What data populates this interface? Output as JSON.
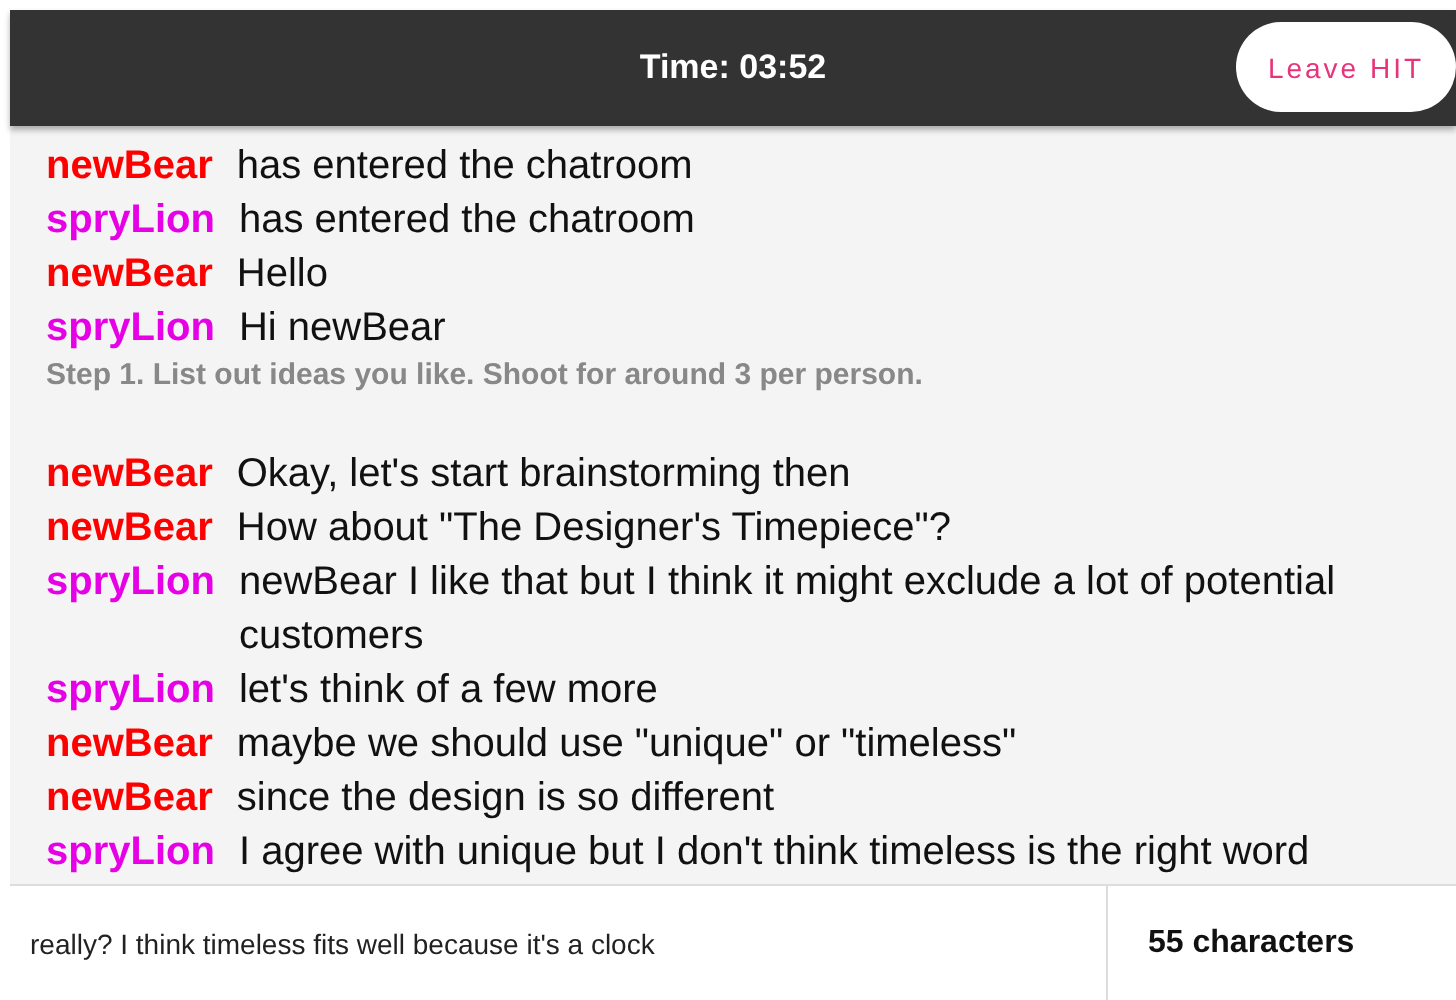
{
  "header": {
    "timer": "Time: 03:52",
    "leave_button": "Leave HIT"
  },
  "messages": [
    {
      "kind": "message",
      "user": "newBear",
      "color": "#ff0000",
      "text": "has entered the chatroom"
    },
    {
      "kind": "message",
      "user": "spryLion",
      "color": "#e600e6",
      "text": "has entered the chatroom"
    },
    {
      "kind": "message",
      "user": "newBear",
      "color": "#ff0000",
      "text": "Hello"
    },
    {
      "kind": "message",
      "user": "spryLion",
      "color": "#e600e6",
      "text": "Hi newBear"
    },
    {
      "kind": "instruction",
      "text": "Step 1. List out ideas you like. Shoot for around 3 per person."
    },
    {
      "kind": "message",
      "user": "newBear",
      "color": "#ff0000",
      "text": "Okay, let's start brainstorming then"
    },
    {
      "kind": "message",
      "user": "newBear",
      "color": "#ff0000",
      "text": "How about \"The Designer's Timepiece\"?"
    },
    {
      "kind": "message",
      "user": "spryLion",
      "color": "#e600e6",
      "text": "newBear I like that but I think it might exclude a lot of potential customers"
    },
    {
      "kind": "message",
      "user": "spryLion",
      "color": "#e600e6",
      "text": "let's think of a few more"
    },
    {
      "kind": "message",
      "user": "newBear",
      "color": "#ff0000",
      "text": "maybe we should use \"unique\" or \"timeless\""
    },
    {
      "kind": "message",
      "user": "newBear",
      "color": "#ff0000",
      "text": "since the design is so different"
    },
    {
      "kind": "message",
      "user": "spryLion",
      "color": "#e600e6",
      "text": "I agree with unique but I don't think timeless is the right word"
    }
  ],
  "composer": {
    "value": "really? I think timeless fits well because it's a clock",
    "count": "55 characters"
  }
}
